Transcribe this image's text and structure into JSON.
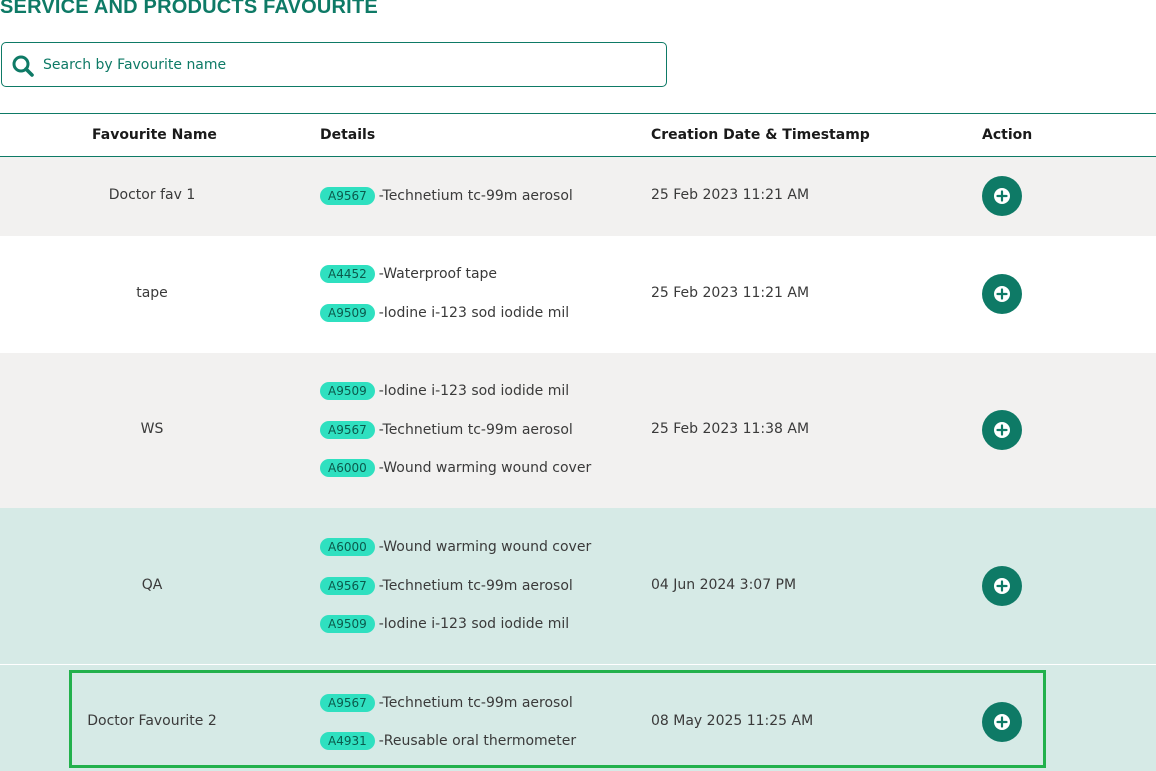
{
  "header": {
    "title": "SERVICE AND PRODUCTS FAVOURITE"
  },
  "search": {
    "placeholder": "Search by Favourite name",
    "value": ""
  },
  "table": {
    "columns": {
      "name": "Favourite Name",
      "details": "Details",
      "date": "Creation Date & Timestamp",
      "action": "Action"
    },
    "rows": [
      {
        "name": "Doctor fav 1",
        "date": "25 Feb 2023 11:21 AM",
        "details": [
          {
            "code": "A9567",
            "text": "-Technetium tc-99m aerosol"
          }
        ]
      },
      {
        "name": "tape",
        "date": "25 Feb 2023 11:21 AM",
        "details": [
          {
            "code": "A4452",
            "text": "-Waterproof tape"
          },
          {
            "code": "A9509",
            "text": "-Iodine i-123 sod iodide mil"
          }
        ]
      },
      {
        "name": "WS",
        "date": "25 Feb 2023 11:38 AM",
        "details": [
          {
            "code": "A9509",
            "text": "-Iodine i-123 sod iodide mil"
          },
          {
            "code": "A9567",
            "text": "-Technetium tc-99m aerosol"
          },
          {
            "code": "A6000",
            "text": "-Wound warming wound cover"
          }
        ]
      },
      {
        "name": "QA",
        "date": "04 Jun 2024 3:07 PM",
        "details": [
          {
            "code": "A6000",
            "text": "-Wound warming wound cover"
          },
          {
            "code": "A9567",
            "text": "-Technetium tc-99m aerosol"
          },
          {
            "code": "A9509",
            "text": "-Iodine i-123 sod iodide mil"
          }
        ]
      },
      {
        "name": "Doctor Favourite 2",
        "date": "08 May 2025 11:25 AM",
        "details": [
          {
            "code": "A9567",
            "text": "-Technetium tc-99m aerosol"
          },
          {
            "code": "A4931",
            "text": "-Reusable oral thermometer"
          }
        ]
      }
    ]
  },
  "colors": {
    "accent": "#0e7a66",
    "badge": "#2fe0c0",
    "row_grey": "#f2f1f0",
    "row_mint": "#d6eae6",
    "highlight": "#22b14c"
  },
  "icons": {
    "search": "search-icon",
    "add": "plus-circle-icon"
  }
}
